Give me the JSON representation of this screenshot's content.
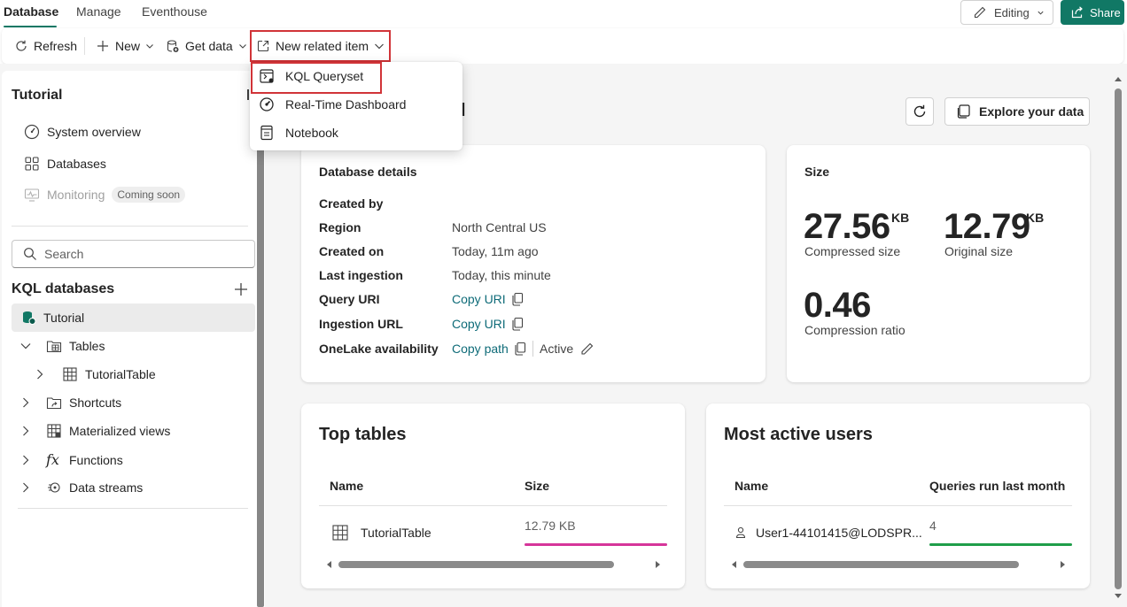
{
  "tabs": [
    {
      "label": "Database",
      "active": true
    },
    {
      "label": "Manage",
      "active": false
    },
    {
      "label": "Eventhouse",
      "active": false
    }
  ],
  "header": {
    "editing_label": "Editing",
    "share_label": "Share"
  },
  "toolbar": {
    "refresh_label": "Refresh",
    "new_label": "New",
    "get_data_label": "Get data",
    "new_related_label": "New related item"
  },
  "menu": {
    "items": [
      {
        "label": "KQL Queryset",
        "icon": "queryset-icon"
      },
      {
        "label": "Real-Time Dashboard",
        "icon": "dashboard-gauge-icon"
      },
      {
        "label": "Notebook",
        "icon": "notebook-icon"
      }
    ]
  },
  "sidebar": {
    "title": "Tutorial",
    "nav": [
      {
        "label": "System overview",
        "icon": "gauge-icon"
      },
      {
        "label": "Databases",
        "icon": "grid-icon"
      },
      {
        "label": "Monitoring",
        "icon": "monitor-icon",
        "badge": "Coming soon"
      }
    ],
    "search_placeholder": "Search",
    "kql_header": "KQL databases",
    "tree": {
      "database": "Tutorial",
      "tables": "Tables",
      "table_item": "TutorialTable",
      "shortcuts": "Shortcuts",
      "materialized_views": "Materialized views",
      "functions": "Functions",
      "data_streams": "Data streams"
    }
  },
  "main": {
    "title_fragment": "l",
    "explore_label": "Explore your data",
    "details": {
      "title": "Database details",
      "rows": [
        {
          "key": "Created by",
          "value": ""
        },
        {
          "key": "Region",
          "value": "North Central US"
        },
        {
          "key": "Created on",
          "value": "Today, 11m ago"
        },
        {
          "key": "Last ingestion",
          "value": "Today, this minute"
        },
        {
          "key": "Query URI",
          "value": "Copy URI"
        },
        {
          "key": "Ingestion URL",
          "value": "Copy URI"
        },
        {
          "key": "OneLake availability",
          "value": "Copy path",
          "status": "Active"
        }
      ]
    },
    "size": {
      "title": "Size",
      "compressed_value": "27.56",
      "compressed_unit": "KB",
      "compressed_label": "Compressed size",
      "original_value": "12.79",
      "original_unit": "KB",
      "original_label": "Original size",
      "ratio_value": "0.46",
      "ratio_label": "Compression ratio"
    },
    "top_tables": {
      "title": "Top tables",
      "col_name": "Name",
      "col_size": "Size",
      "rows": [
        {
          "name": "TutorialTable",
          "size": "12.79 KB",
          "fill": 1.0
        }
      ]
    },
    "active_users": {
      "title": "Most active users",
      "col_name": "Name",
      "col_queries": "Queries run last month",
      "rows": [
        {
          "name": "User1-44101415@LODSPR...",
          "queries": "4",
          "fill": 1.0
        }
      ]
    }
  },
  "colors": {
    "accent": "#117865",
    "highlight": "#d13438",
    "table_bar": "#d6359a",
    "user_bar": "#1f9e4a"
  }
}
